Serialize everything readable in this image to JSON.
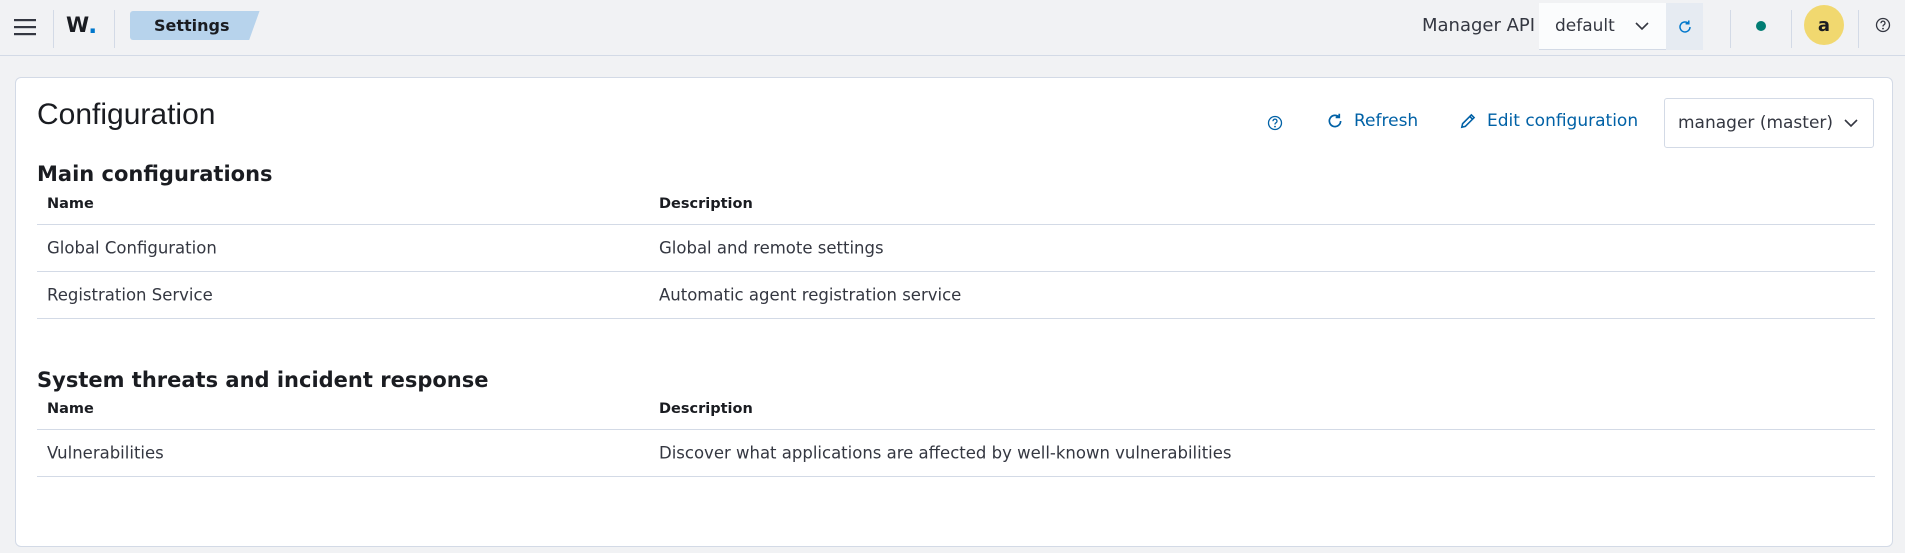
{
  "topbar": {
    "logo": "W",
    "logo_dot": ".",
    "breadcrumb": "Settings",
    "api_label": "Manager API",
    "api_selected": "default",
    "status_color": "#017d73",
    "avatar_letter": "a",
    "icons": [
      "menu-icon",
      "chevron-down-icon",
      "refresh-icon",
      "status-dot",
      "help-icon"
    ]
  },
  "page": {
    "title": "Configuration",
    "actions": {
      "refresh_label": "Refresh",
      "edit_label": "Edit configuration"
    },
    "node_selected": "manager (master)",
    "accent_color": "#0061a6"
  },
  "sections": [
    {
      "title": "Main configurations",
      "columns": [
        "Name",
        "Description"
      ],
      "rows": [
        {
          "name": "Global Configuration",
          "description": "Global and remote settings"
        },
        {
          "name": "Registration Service",
          "description": "Automatic agent registration service"
        }
      ]
    },
    {
      "title": "System threats and incident response",
      "columns": [
        "Name",
        "Description"
      ],
      "rows": [
        {
          "name": "Vulnerabilities",
          "description": "Discover what applications are affected by well-known vulnerabilities"
        }
      ]
    }
  ]
}
